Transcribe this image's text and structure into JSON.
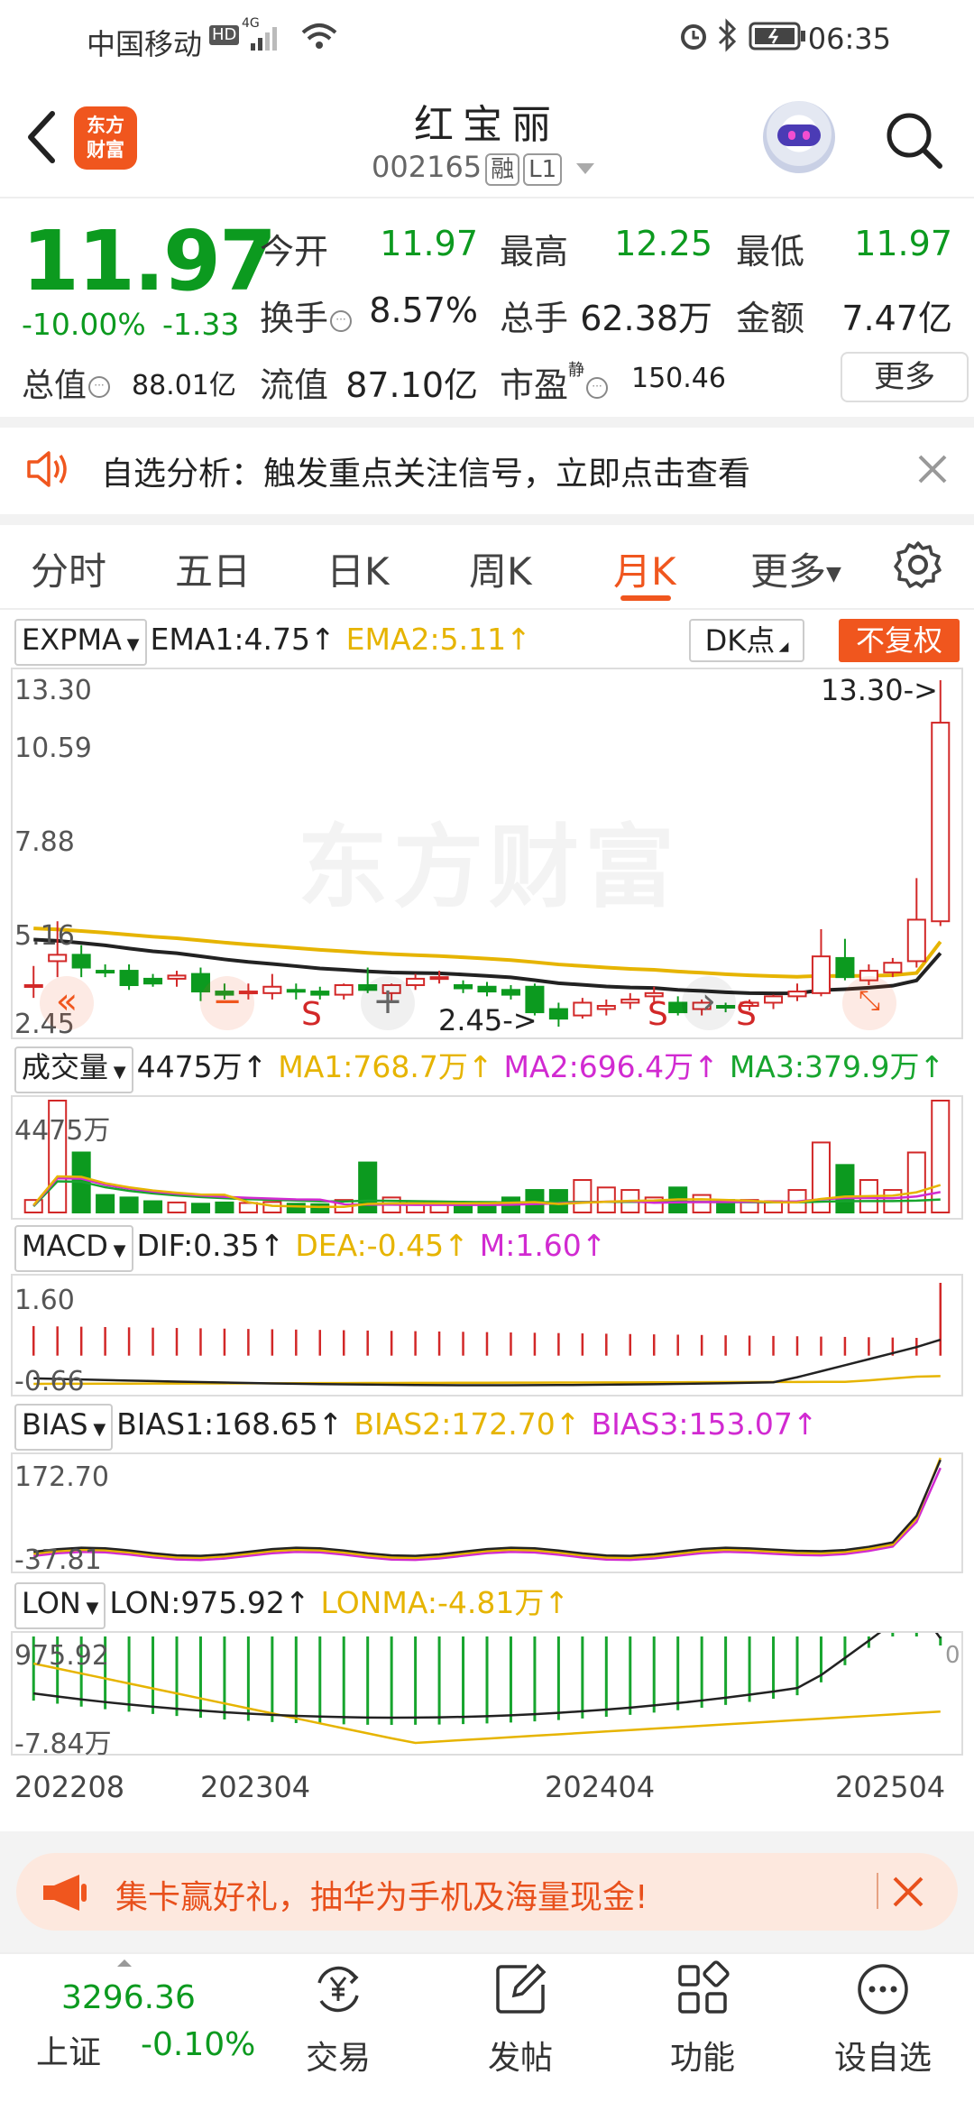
{
  "status_bar": {
    "carrier": "中国移动",
    "network": "4G",
    "time": "06:35"
  },
  "header": {
    "name": "红宝丽",
    "code": "002165",
    "tag_margin": "融",
    "tag_level": "L1"
  },
  "quote": {
    "price": "11.97",
    "change_pct": "-10.00%",
    "change": "-1.33",
    "open_label": "今开",
    "open": "11.97",
    "high_label": "最高",
    "high": "12.25",
    "low_label": "最低",
    "low": "11.97",
    "turnover_label": "换手",
    "turnover": "8.57%",
    "volume_label": "总手",
    "volume": "62.38万",
    "amount_label": "金额",
    "amount": "7.47亿",
    "mcap_label": "总值",
    "mcap": "88.01亿",
    "float_label": "流值",
    "float": "87.10亿",
    "pe_label": "市盈",
    "pe_sup": "静",
    "pe": "150.46",
    "more_label": "更多"
  },
  "notice": {
    "text": "自选分析：触发重点关注信号，立即点击查看"
  },
  "tabs": [
    "分时",
    "五日",
    "日K",
    "周K",
    "月K",
    "更多"
  ],
  "active_tab": "月K",
  "kline": {
    "indicator": "EXPMA",
    "ema1": "EMA1:4.75↑",
    "ema2": "EMA2:5.11↑",
    "dk_label": "DK点",
    "fq_label": "不复权",
    "y_labels": [
      "13.30",
      "10.59",
      "7.88",
      "5.16",
      "2.45"
    ],
    "max_marker": "13.30->",
    "min_marker": "2.45->",
    "watermark": "东方财富",
    "signals": [
      "S",
      "S",
      "S"
    ]
  },
  "volume": {
    "indicator": "成交量",
    "vol": "4475万↑",
    "ma1": "MA1:768.7万↑",
    "ma2": "MA2:696.4万↑",
    "ma3": "MA3:379.9万↑",
    "y_label": "4475万"
  },
  "macd": {
    "indicator": "MACD",
    "dif": "DIF:0.35↑",
    "dea": "DEA:-0.45↑",
    "m": "M:1.60↑",
    "y_top": "1.60",
    "y_bottom": "-0.66"
  },
  "bias": {
    "indicator": "BIAS",
    "bias1": "BIAS1:168.65↑",
    "bias2": "BIAS2:172.70↑",
    "bias3": "BIAS3:153.07↑",
    "y_top": "172.70",
    "y_bottom": "-37.81"
  },
  "lon": {
    "indicator": "LON",
    "lon": "LON:975.92↑",
    "lonma": "LONMA:-4.81万↑",
    "y_top": "975.92",
    "y_bottom": "-7.84万",
    "right_tick": "0"
  },
  "x_axis": [
    "202208",
    "202304",
    "202404",
    "202504"
  ],
  "promo": {
    "text": "集卡赢好礼，抽华为手机及海量现金!"
  },
  "bottom_nav": {
    "index_value": "3296.36",
    "index_name": "上证",
    "index_pct": "-0.10%",
    "items": [
      "交易",
      "发帖",
      "功能",
      "设自选"
    ]
  },
  "colors": {
    "brand": "#f0561e",
    "down": "#0c9a1f",
    "up": "#d22828",
    "ema1": "#222222",
    "ema2": "#e6b400",
    "ma2": "#d12ad1"
  },
  "chart_data": [
    {
      "type": "candlestick",
      "title": "红宝丽 月K",
      "ylim": [
        2.45,
        13.3
      ],
      "x_ticks": [
        "202208",
        "202304",
        "202404",
        "202504"
      ],
      "ohlc": [
        [
          3.75,
          4.35,
          3.35,
          3.75
        ],
        [
          4.5,
          5.75,
          4.0,
          4.7
        ],
        [
          4.7,
          5.0,
          4.0,
          4.3
        ],
        [
          4.2,
          4.4,
          4.0,
          4.15
        ],
        [
          4.2,
          4.4,
          3.6,
          3.75
        ],
        [
          3.95,
          4.1,
          3.7,
          3.8
        ],
        [
          3.95,
          4.2,
          3.7,
          4.05
        ],
        [
          4.1,
          4.3,
          3.25,
          3.55
        ],
        [
          3.55,
          3.8,
          3.3,
          3.45
        ],
        [
          3.55,
          3.8,
          3.3,
          3.55
        ],
        [
          3.5,
          4.1,
          3.3,
          3.7
        ],
        [
          3.6,
          3.8,
          3.3,
          3.55
        ],
        [
          3.55,
          3.7,
          3.3,
          3.45
        ],
        [
          3.45,
          3.8,
          3.3,
          3.75
        ],
        [
          3.75,
          4.3,
          3.5,
          3.6
        ],
        [
          3.5,
          3.8,
          3.2,
          3.75
        ],
        [
          3.75,
          4.1,
          3.6,
          3.95
        ],
        [
          3.95,
          4.2,
          3.8,
          4.0
        ],
        [
          3.75,
          3.9,
          3.5,
          3.65
        ],
        [
          3.7,
          3.85,
          3.4,
          3.55
        ],
        [
          3.6,
          3.75,
          3.3,
          3.45
        ],
        [
          3.7,
          3.8,
          2.8,
          2.9
        ],
        [
          3.0,
          3.2,
          2.45,
          2.7
        ],
        [
          2.8,
          3.35,
          2.7,
          3.2
        ],
        [
          3.0,
          3.3,
          2.8,
          3.1
        ],
        [
          3.2,
          3.5,
          3.0,
          3.3
        ],
        [
          3.4,
          3.7,
          3.2,
          3.5
        ],
        [
          3.2,
          3.4,
          2.8,
          2.9
        ],
        [
          3.0,
          3.3,
          2.8,
          3.2
        ],
        [
          3.1,
          3.2,
          2.9,
          3.05
        ],
        [
          3.1,
          3.3,
          2.95,
          3.2
        ],
        [
          3.2,
          3.45,
          3.0,
          3.4
        ],
        [
          3.4,
          3.8,
          3.25,
          3.55
        ],
        [
          3.5,
          5.5,
          3.4,
          4.65
        ],
        [
          4.6,
          5.2,
          3.9,
          4.0
        ],
        [
          3.9,
          4.4,
          3.75,
          4.2
        ],
        [
          4.15,
          4.6,
          4.0,
          4.45
        ],
        [
          4.5,
          7.1,
          4.3,
          5.8
        ],
        [
          5.75,
          13.3,
          5.6,
          11.97
        ]
      ],
      "series": [
        {
          "name": "EMA1",
          "last": 4.75
        },
        {
          "name": "EMA2",
          "last": 5.11
        }
      ]
    },
    {
      "type": "bar",
      "title": "成交量",
      "ylim": [
        0,
        4475
      ],
      "y_unit": "万",
      "values": [
        500,
        4475,
        2400,
        700,
        600,
        450,
        400,
        350,
        400,
        380,
        420,
        350,
        330,
        500,
        2000,
        600,
        450,
        400,
        380,
        420,
        600,
        900,
        900,
        1300,
        1000,
        900,
        600,
        1000,
        700,
        500,
        500,
        450,
        900,
        2800,
        1900,
        1300,
        900,
        2400,
        4475
      ]
    },
    {
      "type": "line",
      "title": "MACD",
      "ylim": [
        -0.66,
        1.6
      ],
      "series": [
        {
          "name": "DIF",
          "last": 0.35
        },
        {
          "name": "DEA",
          "last": -0.45
        },
        {
          "name": "M",
          "last": 1.6
        }
      ]
    },
    {
      "type": "line",
      "title": "BIAS",
      "ylim": [
        -37.81,
        172.7
      ],
      "series": [
        {
          "name": "BIAS1",
          "last": 168.65
        },
        {
          "name": "BIAS2",
          "last": 172.7
        },
        {
          "name": "BIAS3",
          "last": 153.07
        }
      ]
    },
    {
      "type": "line",
      "title": "LON",
      "series": [
        {
          "name": "LON",
          "last": 975.92
        },
        {
          "name": "LONMA",
          "last": -48100
        }
      ]
    }
  ]
}
